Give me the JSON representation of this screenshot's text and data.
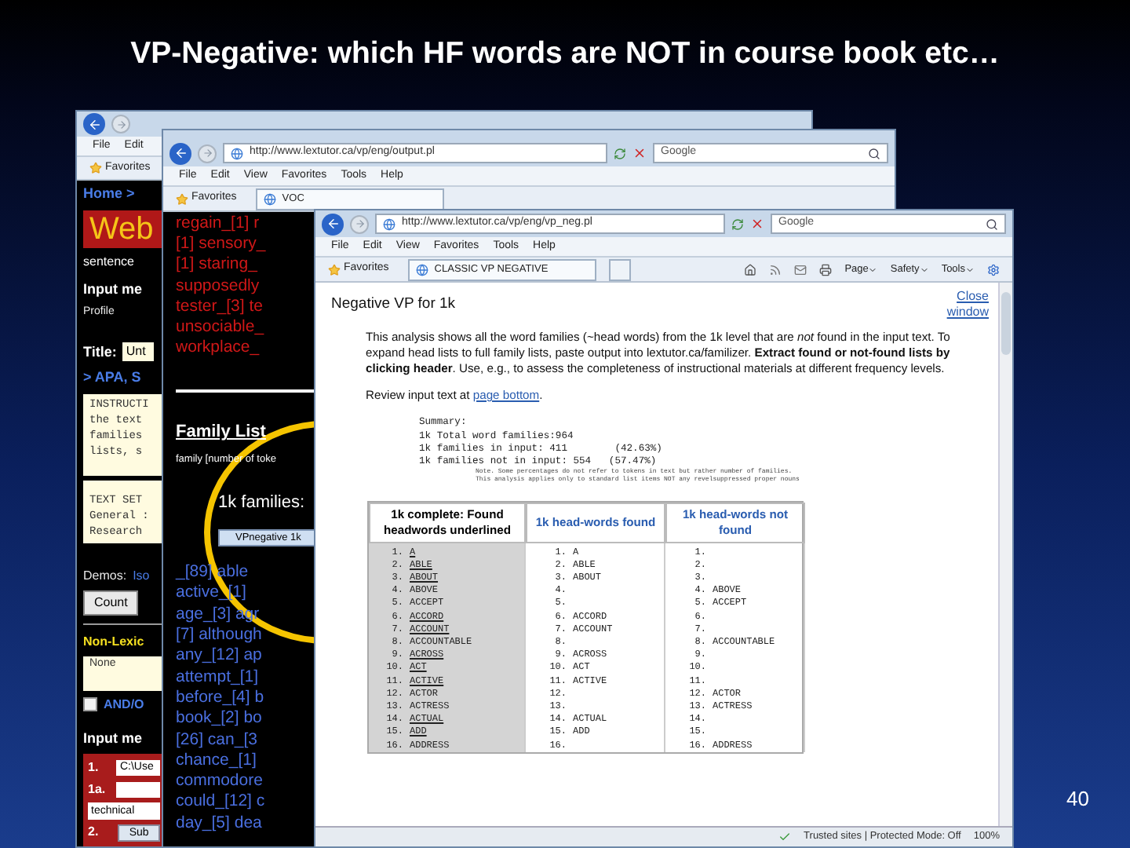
{
  "slide": {
    "title": "VP-Negative: which HF words are NOT in course book etc…",
    "page_number": "40"
  },
  "back_window": {
    "menu": [
      "File",
      "Edit"
    ],
    "favorites": "Favorites",
    "page": {
      "breadcrumb": "Home >",
      "banner": "Web",
      "subtitle": "sentence",
      "input_heading": "Input me",
      "profile_label": "Profile",
      "title_label": "Title:",
      "title_value": "Unt",
      "links": "> APA, S",
      "instructions": [
        "INSTRUCTI",
        "the text",
        "families",
        "lists, s"
      ],
      "text_set": [
        "TEXT SET",
        "General :",
        "Research"
      ],
      "demos_label": "Demos:",
      "demos_link": "Iso",
      "count_button": "Count",
      "nonlex_label": "Non-Lexic",
      "nonlex_value": "None",
      "andor": {
        "label": "AND/O",
        "checked": false
      },
      "input_heading_2": "Input me",
      "steps": [
        {
          "kind": "input",
          "number": "1.",
          "value": "C:\\Use"
        },
        {
          "kind": "input",
          "number": "1a."
        },
        {
          "kind": "select",
          "value": "technical"
        },
        {
          "kind": "button",
          "number": "2.",
          "label": "Sub"
        }
      ]
    }
  },
  "middle_window": {
    "address": "http://www.lextutor.ca/vp/eng/output.pl",
    "search": "Google",
    "menu": [
      "File",
      "Edit",
      "View",
      "Favorites",
      "Tools",
      "Help"
    ],
    "favorites": "Favorites",
    "tab": "VOC",
    "page": {
      "red_lines": [
        "regain_[1] r",
        "[1] sensory_",
        "[1] staring_",
        "supposedly",
        "tester_[3] te",
        "unsociable_",
        "workplace_"
      ],
      "section_title": "Family List",
      "family_caption": "family  [number of toke",
      "families_label": "1k families:",
      "vp_button": "VPnegative 1k",
      "blue_lines": [
        "_[89] able",
        "active_[1]",
        "age_[3] agr",
        "[7] although",
        "any_[12] ap",
        "attempt_[1]",
        "before_[4] b",
        "book_[2] bo",
        "[26] can_[3",
        "chance_[1]",
        "commodore",
        "could_[12] c",
        "day_[5] dea"
      ]
    }
  },
  "front_window": {
    "address": "http://www.lextutor.ca/vp/eng/vp_neg.pl",
    "search": "Google",
    "menu": [
      "File",
      "Edit",
      "View",
      "Favorites",
      "Tools",
      "Help"
    ],
    "favorites": "Favorites",
    "tab": "CLASSIC VP NEGATIVE",
    "commands": [
      "Page",
      "Safety",
      "Tools"
    ],
    "heading": "Negative VP for 1k",
    "close_link": "Close window",
    "intro": "This analysis shows all the word families (~head words) from the 1k level that are *not* found in the input text. To expand head lists to full family lists, paste output into lextutor.ca/familizer. **Extract found or not-found lists by clicking header**. Use, e.g., to assess the completeness of instructional materials at different frequency levels.",
    "review": {
      "text": "Review input text at",
      "link": "page bottom",
      "end": "."
    },
    "summary": [
      "Summary:",
      "1k Total word families:964",
      "1k families in input: 411        (42.63%)",
      "1k families not in input: 554   (57.47%)"
    ],
    "note": [
      "Note. Some percentages do not refer to tokens in text but rather number of families.",
      "This analysis applies only to standard list items NOT any revelsuppressed proper nouns"
    ],
    "table": {
      "columns": [
        "1k complete: Found headwords underlined",
        "1k head-words found",
        "1k head-words not found"
      ],
      "rows": [
        {
          "n1": "1.",
          "w1": "A",
          "underlined": true,
          "n2": "1.",
          "w2": "A",
          "n3": "1."
        },
        {
          "n1": "2.",
          "w1": "ABLE",
          "underlined": true,
          "n2": "2.",
          "w2": "ABLE",
          "n3": "2."
        },
        {
          "n1": "3.",
          "w1": "ABOUT",
          "underlined": true,
          "n2": "3.",
          "w2": "ABOUT",
          "n3": "3."
        },
        {
          "n1": "4.",
          "w1": "ABOVE",
          "underlined": false,
          "n2": "4.",
          "n3": "4.",
          "w3": "ABOVE"
        },
        {
          "n1": "5.",
          "w1": "ACCEPT",
          "underlined": false,
          "n2": "5.",
          "n3": "5.",
          "w3": "ACCEPT"
        },
        {
          "n1": "6.",
          "w1": "ACCORD",
          "underlined": true,
          "n2": "6.",
          "w2": "ACCORD",
          "n3": "6."
        },
        {
          "n1": "7.",
          "w1": "ACCOUNT",
          "underlined": true,
          "n2": "7.",
          "w2": "ACCOUNT",
          "n3": "7."
        },
        {
          "n1": "8.",
          "w1": "ACCOUNTABLE",
          "underlined": false,
          "n2": "8.",
          "n3": "8.",
          "w3": "ACCOUNTABLE"
        },
        {
          "n1": "9.",
          "w1": "ACROSS",
          "underlined": true,
          "n2": "9.",
          "w2": "ACROSS",
          "n3": "9."
        },
        {
          "n1": "10.",
          "w1": "ACT",
          "underlined": true,
          "n2": "10.",
          "w2": "ACT",
          "n3": "10."
        },
        {
          "n1": "11.",
          "w1": "ACTIVE",
          "underlined": true,
          "n2": "11.",
          "w2": "ACTIVE",
          "n3": "11."
        },
        {
          "n1": "12.",
          "w1": "ACTOR",
          "underlined": false,
          "n2": "12.",
          "n3": "12.",
          "w3": "ACTOR"
        },
        {
          "n1": "13.",
          "w1": "ACTRESS",
          "underlined": false,
          "n2": "13.",
          "n3": "13.",
          "w3": "ACTRESS"
        },
        {
          "n1": "14.",
          "w1": "ACTUAL",
          "underlined": true,
          "n2": "14.",
          "w2": "ACTUAL",
          "n3": "14."
        },
        {
          "n1": "15.",
          "w1": "ADD",
          "underlined": true,
          "n2": "15.",
          "w2": "ADD",
          "n3": "15."
        },
        {
          "n1": "16.",
          "w1": "ADDRESS",
          "underlined": false,
          "n2": "16.",
          "n3": "16.",
          "w3": "ADDRESS"
        }
      ]
    },
    "status": {
      "zone": "Trusted sites | Protected Mode: Off",
      "zoom": "100%"
    }
  }
}
